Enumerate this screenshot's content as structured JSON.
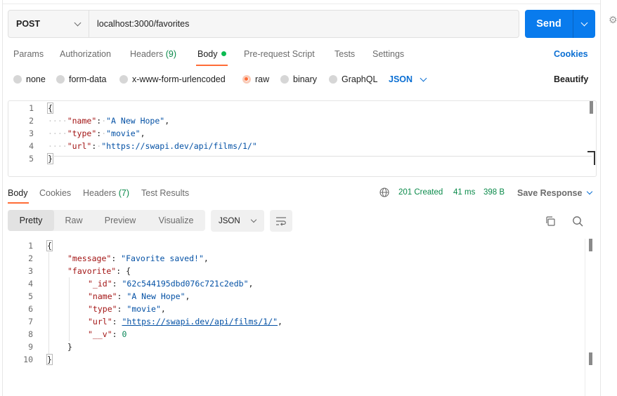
{
  "request": {
    "method": "POST",
    "url": "localhost:3000/favorites",
    "send_label": "Send"
  },
  "request_tabs": [
    {
      "label": "Params"
    },
    {
      "label": "Authorization"
    },
    {
      "label": "Headers",
      "count": "(9)"
    },
    {
      "label": "Body"
    },
    {
      "label": "Pre-request Script"
    },
    {
      "label": "Tests"
    },
    {
      "label": "Settings"
    }
  ],
  "cookies_label": "Cookies",
  "body_types": [
    {
      "label": "none"
    },
    {
      "label": "form-data"
    },
    {
      "label": "x-www-form-urlencoded"
    },
    {
      "label": "raw",
      "selected": true
    },
    {
      "label": "binary"
    },
    {
      "label": "GraphQL"
    }
  ],
  "body_format": "JSON",
  "beautify_label": "Beautify",
  "request_body": {
    "line_numbers": [
      "1",
      "2",
      "3",
      "4",
      "5"
    ],
    "open": "{",
    "close": "}",
    "entries": [
      {
        "key": "\"name\"",
        "value": "\"A New Hope\"",
        "comma": ","
      },
      {
        "key": "\"type\"",
        "value": "\"movie\"",
        "comma": ","
      },
      {
        "key": "\"url\"",
        "value": "\"https://swapi.dev/api/films/1/\"",
        "comma": ""
      }
    ]
  },
  "response_tabs": [
    {
      "label": "Body"
    },
    {
      "label": "Cookies"
    },
    {
      "label": "Headers",
      "count": "(7)"
    },
    {
      "label": "Test Results"
    }
  ],
  "response_status": {
    "status": "201 Created",
    "time": "41 ms",
    "size": "398 B"
  },
  "save_response_label": "Save Response",
  "view_modes": [
    "Pretty",
    "Raw",
    "Preview",
    "Visualize"
  ],
  "response_format": "JSON",
  "response_body": {
    "line_numbers": [
      "1",
      "2",
      "3",
      "4",
      "5",
      "6",
      "7",
      "8",
      "9",
      "10"
    ],
    "open": "{",
    "close": "}",
    "message_key": "\"message\"",
    "message_value": "\"Favorite saved!\"",
    "favorite_key": "\"favorite\"",
    "favorite_open": "{",
    "favorite_close": "}",
    "fields": [
      {
        "key": "\"_id\"",
        "value": "\"62c544195dbd076c721c2edb\"",
        "kind": "str"
      },
      {
        "key": "\"name\"",
        "value": "\"A New Hope\"",
        "kind": "str"
      },
      {
        "key": "\"type\"",
        "value": "\"movie\"",
        "kind": "str"
      },
      {
        "key": "\"url\"",
        "value": "\"https://swapi.dev/api/films/1/\"",
        "kind": "url"
      },
      {
        "key": "\"__v\"",
        "value": "0",
        "kind": "num"
      }
    ]
  },
  "icons": {
    "method_dropdown": "chevron-down-icon",
    "send_dropdown": "chevron-down-icon",
    "globe": "globe-icon",
    "wrap": "wrap-lines-icon",
    "copy": "copy-icon",
    "search": "search-icon",
    "settings": "gear-icon"
  },
  "colors": {
    "accent": "#ff6c37",
    "send": "#097bed",
    "link": "#0b6fd3",
    "status_ok": "#0a8a4a"
  }
}
